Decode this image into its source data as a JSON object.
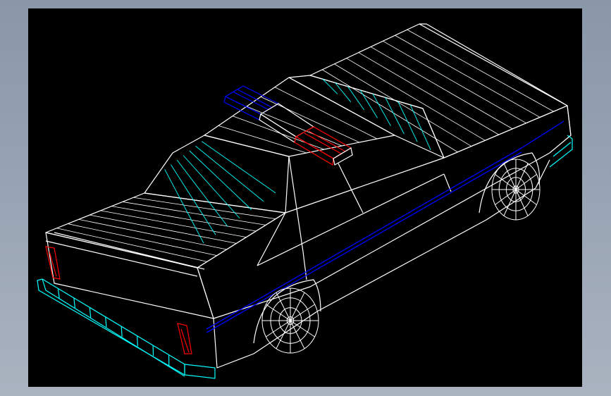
{
  "drawing": {
    "subject": "police-car-wireframe",
    "view": "isometric",
    "colors": {
      "background": "#000000",
      "frame": "#929eae",
      "body_lines": "#ffffff",
      "mesh_lines": "#00ffff",
      "stripe": "#0000ff",
      "taillights": "#ff0000",
      "lightbar_blue": "#0000ff",
      "lightbar_red": "#ff0000"
    }
  }
}
